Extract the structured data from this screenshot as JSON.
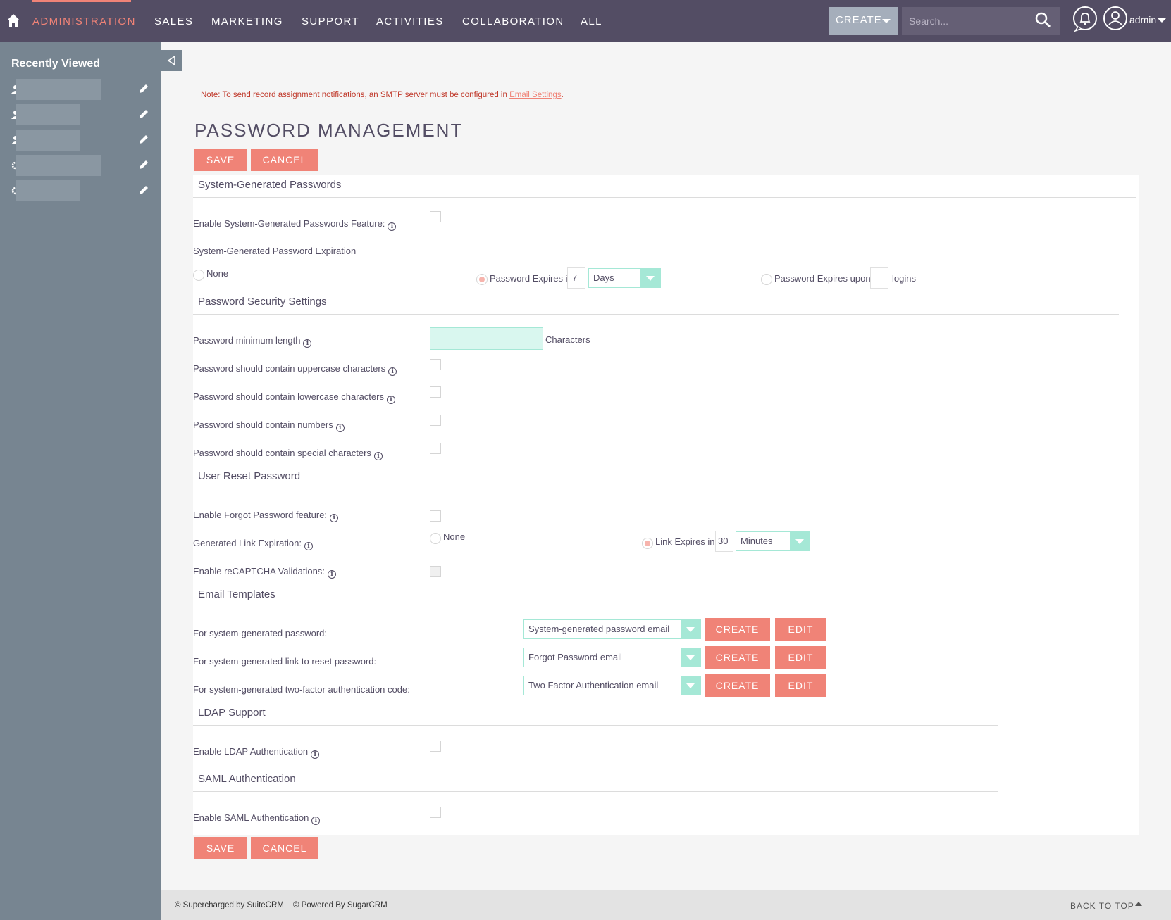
{
  "nav": {
    "items": [
      {
        "label": "ADMINISTRATION",
        "active": true
      },
      {
        "label": "SALES"
      },
      {
        "label": "MARKETING"
      },
      {
        "label": "SUPPORT"
      },
      {
        "label": "ACTIVITIES"
      },
      {
        "label": "COLLABORATION"
      },
      {
        "label": "ALL"
      }
    ],
    "create_label": "CREATE",
    "search_placeholder": "Search...",
    "user": "admin",
    "icons": {
      "home": "home-icon",
      "search": "search-icon",
      "bell": "bell-icon",
      "user": "user-circle-icon"
    }
  },
  "sidebar": {
    "title": "Recently Viewed",
    "items": [
      {
        "icon": "user-icon"
      },
      {
        "icon": "user-icon"
      },
      {
        "icon": "user-icon"
      },
      {
        "icon": "gear-icon"
      },
      {
        "icon": "gear-icon"
      }
    ]
  },
  "note": {
    "text": "Note: To send record assignment notifications, an SMTP server must be configured in ",
    "link": "Email Settings",
    "end": "."
  },
  "page_title": "PASSWORD MANAGEMENT",
  "buttons": {
    "save": "SAVE",
    "cancel": "CANCEL"
  },
  "sections": {
    "system_generated": {
      "title": "System-Generated Passwords",
      "enable_label": "Enable System-Generated Passwords Feature:",
      "expiration_label": "System-Generated Password Expiration",
      "none_label": "None",
      "expires_in_label": "Password Expires in",
      "expires_in_value": "7",
      "expires_unit": "Days",
      "expires_upon_label": "Password Expires upon",
      "expires_upon_value": "",
      "logins_label": "logins"
    },
    "security": {
      "title": "Password Security Settings",
      "min_length_label": "Password minimum length",
      "min_length_value": "",
      "characters_label": "Characters",
      "uppercase_label": "Password should contain uppercase characters",
      "lowercase_label": "Password should contain lowercase characters",
      "numbers_label": "Password should contain numbers",
      "special_label": "Password should contain special characters"
    },
    "reset": {
      "title": "User Reset Password",
      "forgot_label": "Enable Forgot Password feature:",
      "link_exp_label": "Generated Link Expiration:",
      "none_label": "None",
      "link_expires_label": "Link Expires in",
      "link_expires_value": "30",
      "link_unit": "Minutes",
      "recaptcha_label": "Enable reCAPTCHA Validations:"
    },
    "templates": {
      "title": "Email Templates",
      "rows": [
        {
          "label": "For system-generated password:",
          "value": "System-generated password email"
        },
        {
          "label": "For system-generated link to reset password:",
          "value": "Forgot Password email"
        },
        {
          "label": "For system-generated two-factor authentication code:",
          "value": "Two Factor Authentication email"
        }
      ],
      "create_label": "CREATE",
      "edit_label": "EDIT"
    },
    "ldap": {
      "title": "LDAP Support",
      "enable_label": "Enable LDAP Authentication"
    },
    "saml": {
      "title": "SAML Authentication",
      "enable_label": "Enable SAML Authentication"
    }
  },
  "footer": {
    "suitecrm": "© Supercharged by SuiteCRM",
    "sugarcrm": "© Powered By SugarCRM",
    "back_to_top": "BACK TO TOP"
  },
  "colors": {
    "nav_bg": "#534d64",
    "accent": "#f08377",
    "sidebar_bg": "#778591",
    "select_accent": "#a5e8d6"
  }
}
